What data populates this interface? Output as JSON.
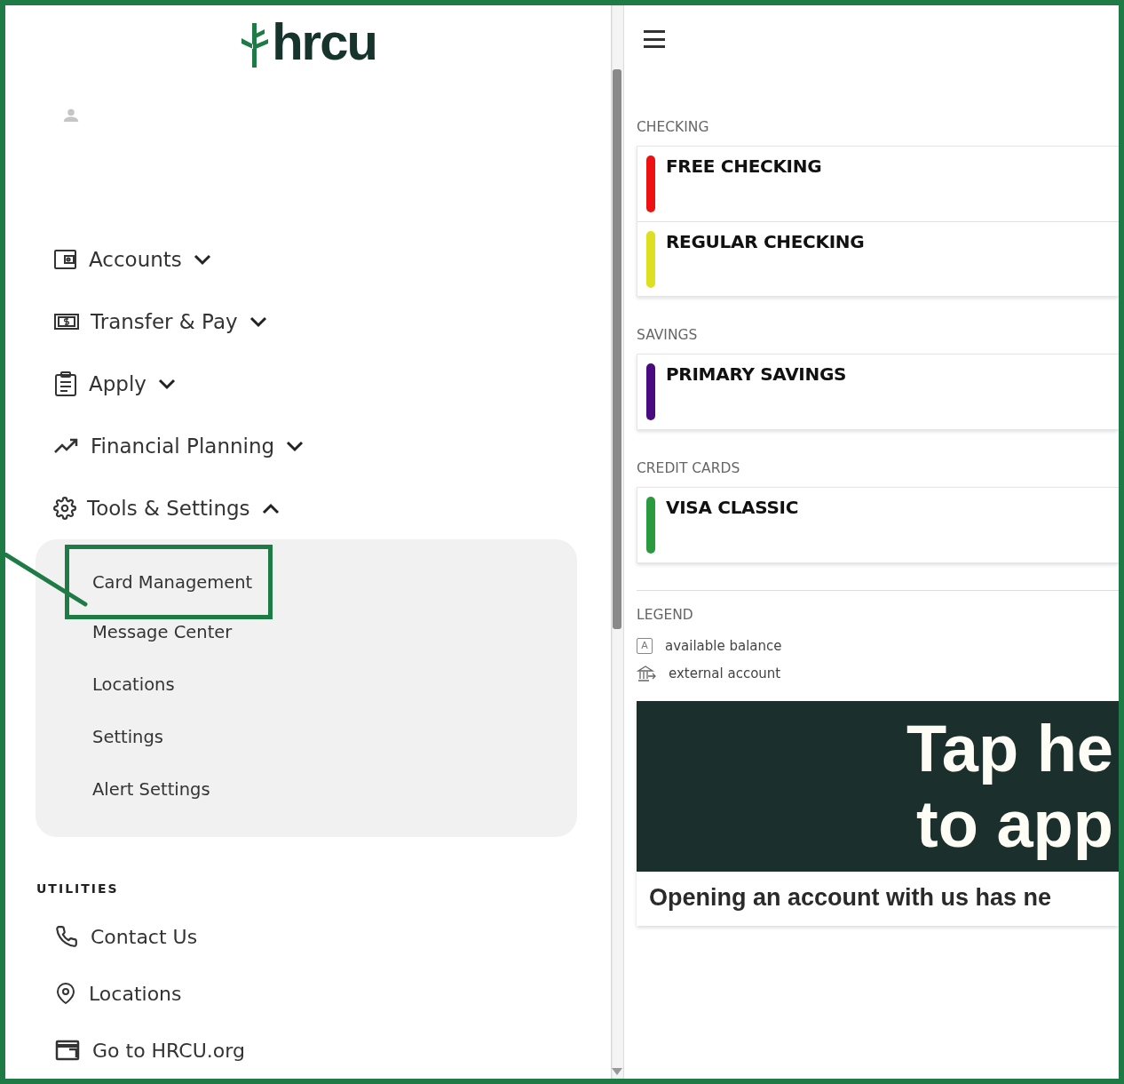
{
  "logo": {
    "text": "hrcu"
  },
  "nav": [
    {
      "label": "Accounts",
      "expanded": false
    },
    {
      "label": "Transfer & Pay",
      "expanded": false
    },
    {
      "label": "Apply",
      "expanded": false
    },
    {
      "label": "Financial Planning",
      "expanded": false
    },
    {
      "label": "Tools & Settings",
      "expanded": true,
      "children": [
        {
          "label": "Card Management",
          "highlighted": true
        },
        {
          "label": "Message Center",
          "highlighted": false
        },
        {
          "label": "Locations",
          "highlighted": false
        },
        {
          "label": "Settings",
          "highlighted": false
        },
        {
          "label": "Alert Settings",
          "highlighted": false
        }
      ]
    }
  ],
  "utilities": {
    "title": "UTILITIES",
    "items": [
      {
        "label": "Contact Us"
      },
      {
        "label": "Locations"
      },
      {
        "label": "Go to HRCU.org"
      }
    ]
  },
  "account_groups": [
    {
      "title": "CHECKING",
      "accounts": [
        {
          "name": "FREE CHECKING",
          "color": "#ee1111"
        },
        {
          "name": "REGULAR CHECKING",
          "color": "#dede22"
        }
      ]
    },
    {
      "title": "SAVINGS",
      "accounts": [
        {
          "name": "PRIMARY SAVINGS",
          "color": "#4a0a80"
        }
      ]
    },
    {
      "title": "CREDIT CARDS",
      "accounts": [
        {
          "name": "VISA CLASSIC",
          "color": "#2a9a3e"
        }
      ]
    }
  ],
  "legend": {
    "title": "LEGEND",
    "items": [
      {
        "label": "available balance",
        "symbol": "A"
      },
      {
        "label": "external account"
      }
    ]
  },
  "banner": {
    "lines": [
      "Tap he",
      "to app"
    ],
    "caption": "Opening an account with us has ne"
  }
}
